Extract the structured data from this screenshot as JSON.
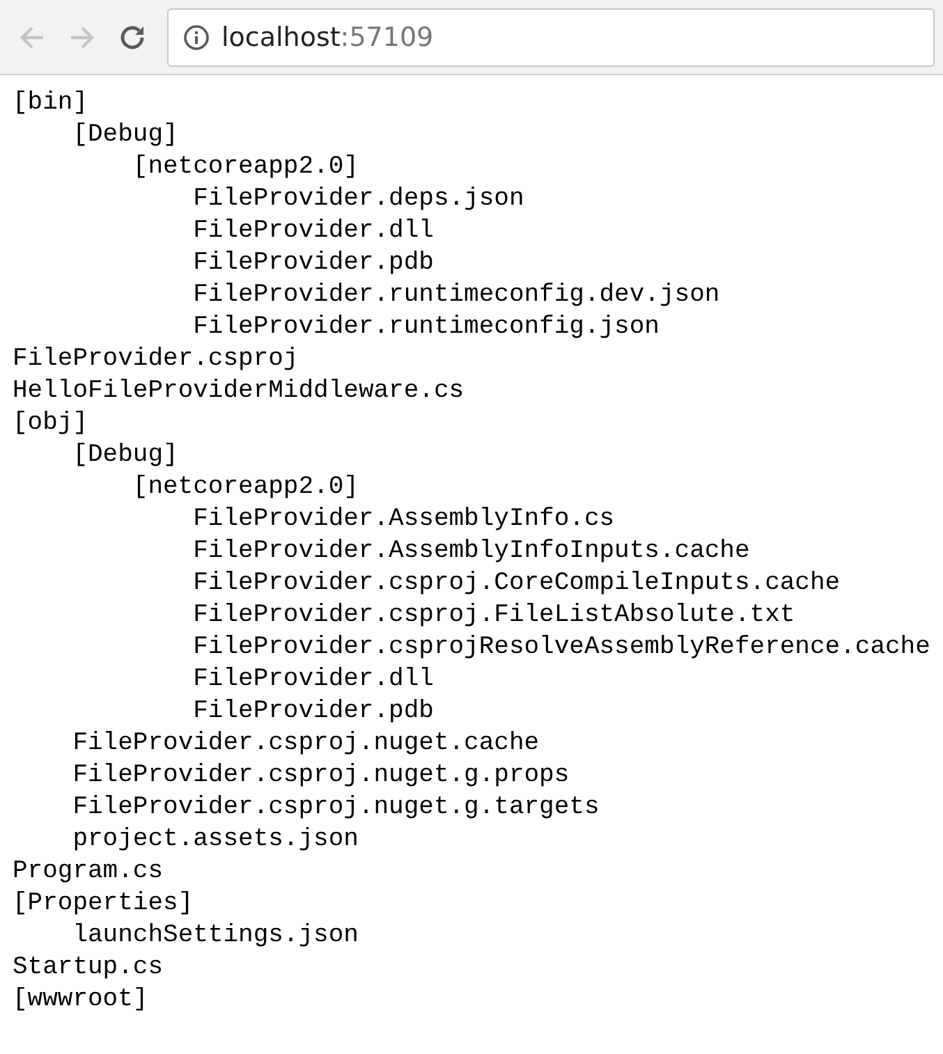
{
  "browser": {
    "address": {
      "host": "localhost",
      "port": ":57109"
    }
  },
  "tree": [
    {
      "name": "[bin]",
      "children": [
        {
          "name": "[Debug]",
          "children": [
            {
              "name": "[netcoreapp2.0]",
              "children": [
                {
                  "name": "FileProvider.deps.json"
                },
                {
                  "name": "FileProvider.dll"
                },
                {
                  "name": "FileProvider.pdb"
                },
                {
                  "name": "FileProvider.runtimeconfig.dev.json"
                },
                {
                  "name": "FileProvider.runtimeconfig.json"
                }
              ]
            }
          ]
        }
      ]
    },
    {
      "name": "FileProvider.csproj"
    },
    {
      "name": "HelloFileProviderMiddleware.cs"
    },
    {
      "name": "[obj]",
      "children": [
        {
          "name": "[Debug]",
          "children": [
            {
              "name": "[netcoreapp2.0]",
              "children": [
                {
                  "name": "FileProvider.AssemblyInfo.cs"
                },
                {
                  "name": "FileProvider.AssemblyInfoInputs.cache"
                },
                {
                  "name": "FileProvider.csproj.CoreCompileInputs.cache"
                },
                {
                  "name": "FileProvider.csproj.FileListAbsolute.txt"
                },
                {
                  "name": "FileProvider.csprojResolveAssemblyReference.cache"
                },
                {
                  "name": "FileProvider.dll"
                },
                {
                  "name": "FileProvider.pdb"
                }
              ]
            }
          ]
        },
        {
          "name": "FileProvider.csproj.nuget.cache"
        },
        {
          "name": "FileProvider.csproj.nuget.g.props"
        },
        {
          "name": "FileProvider.csproj.nuget.g.targets"
        },
        {
          "name": "project.assets.json"
        }
      ]
    },
    {
      "name": "Program.cs"
    },
    {
      "name": "[Properties]",
      "children": [
        {
          "name": "launchSettings.json"
        }
      ]
    },
    {
      "name": "Startup.cs"
    },
    {
      "name": "[wwwroot]"
    }
  ]
}
